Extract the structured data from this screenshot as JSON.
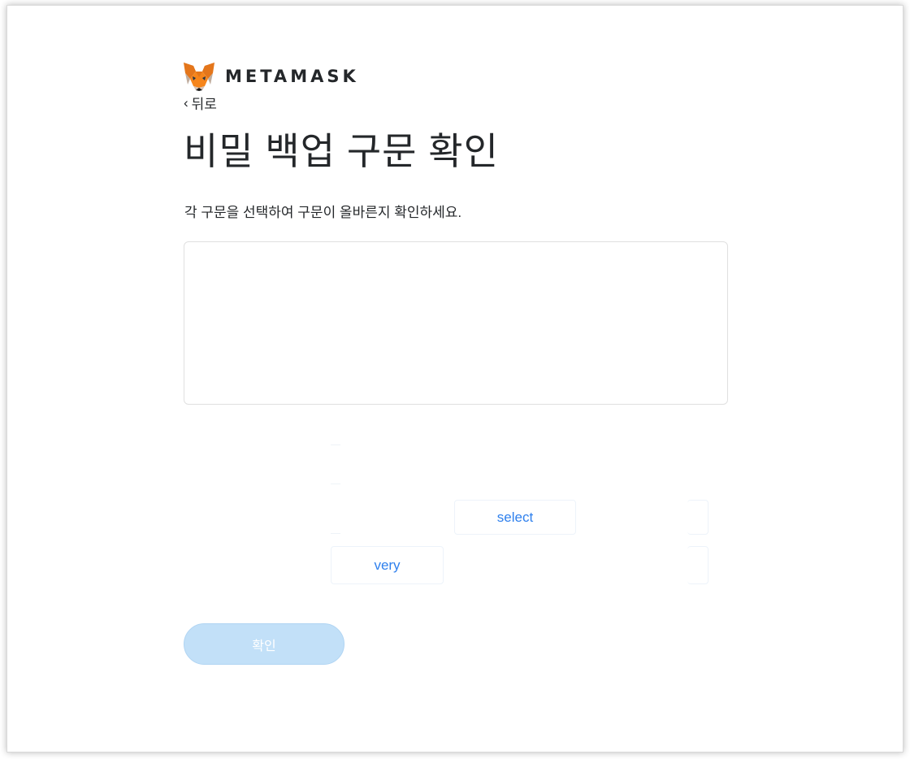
{
  "header": {
    "brand": "METAMASK",
    "back_label": "뒤로"
  },
  "page": {
    "title": "비밀 백업 구문 확인",
    "subtitle": "각 구문을 선택하여 구문이 올바른지 확인하세요."
  },
  "word_chips": [
    {
      "label": "select"
    },
    {
      "label": "very"
    }
  ],
  "confirm_button": {
    "label": "확인"
  },
  "colors": {
    "accent": "#2f80ed",
    "button_disabled": "#c2e0f8",
    "text": "#24272a",
    "fox_orange": "#e2761b"
  },
  "icons": {
    "logo": "metamask-fox-icon",
    "back": "chevron-left-icon"
  }
}
